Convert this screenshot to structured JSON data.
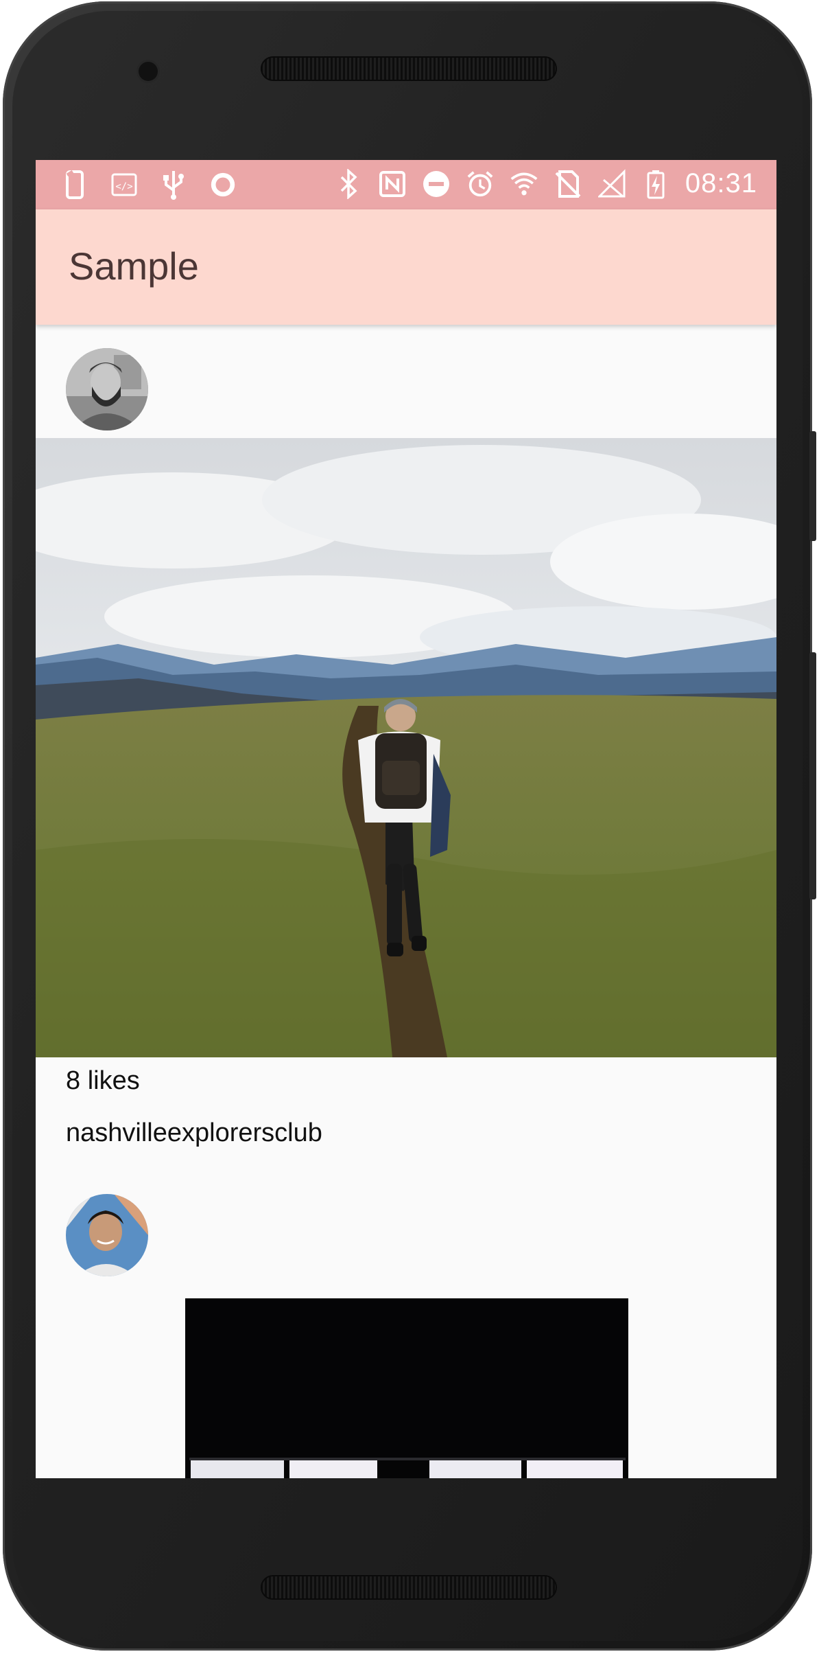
{
  "status_bar": {
    "time": "08:31",
    "left_icons": [
      "screen-rotation-icon",
      "code-icon",
      "usb-icon",
      "record-icon"
    ],
    "right_icons": [
      "bluetooth-icon",
      "nfc-icon",
      "do-not-disturb-icon",
      "alarm-icon",
      "wifi-icon",
      "no-sim-icon",
      "signal-icon",
      "battery-charging-icon"
    ]
  },
  "app_bar": {
    "title": "Sample"
  },
  "feed": {
    "posts": [
      {
        "likes": "8 likes",
        "username": "nashvilleexplorersclub"
      }
    ]
  },
  "colors": {
    "status_bar": "#eba7a8",
    "app_bar": "#fdd8cf",
    "title_text": "#4b3635",
    "background": "#fafafa"
  }
}
